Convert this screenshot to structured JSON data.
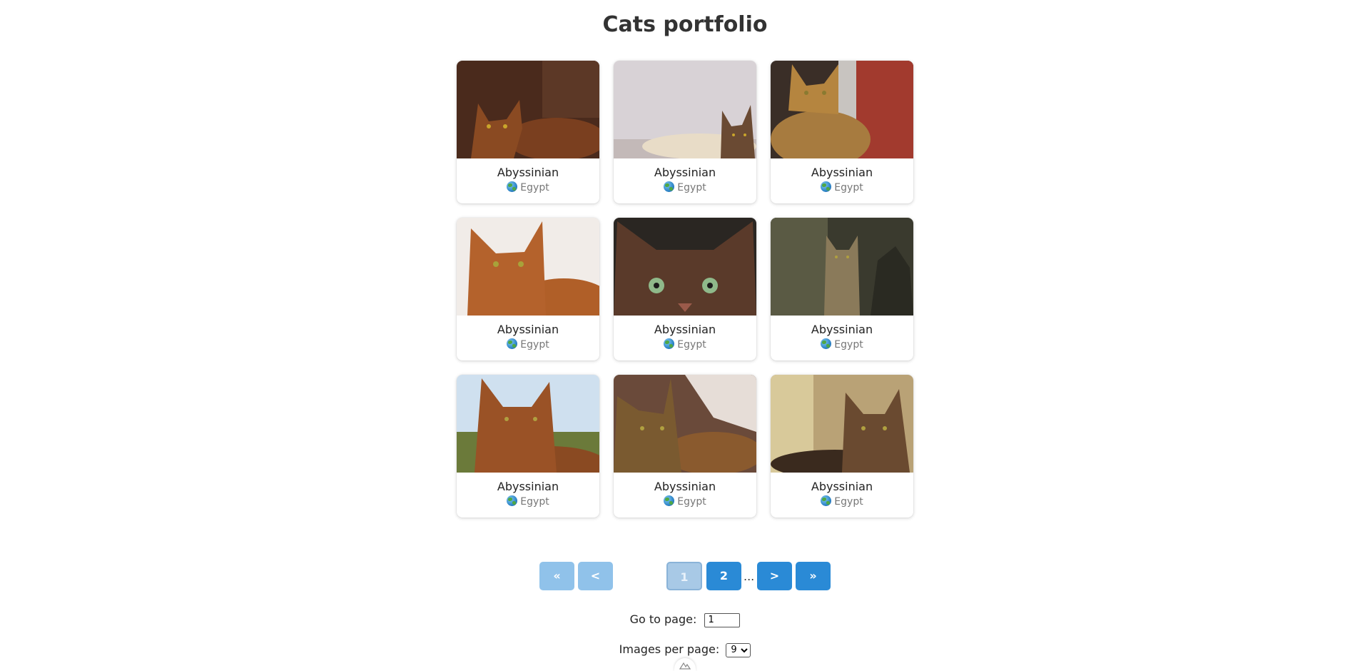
{
  "page": {
    "title": "Cats portfolio"
  },
  "cards": [
    {
      "name": "Abyssinian",
      "origin": "Egypt",
      "photo_icon": "cat-photo-icon"
    },
    {
      "name": "Abyssinian",
      "origin": "Egypt",
      "photo_icon": "cat-photo-icon"
    },
    {
      "name": "Abyssinian",
      "origin": "Egypt",
      "photo_icon": "cat-photo-icon"
    },
    {
      "name": "Abyssinian",
      "origin": "Egypt",
      "photo_icon": "cat-photo-icon"
    },
    {
      "name": "Abyssinian",
      "origin": "Egypt",
      "photo_icon": "cat-photo-icon"
    },
    {
      "name": "Abyssinian",
      "origin": "Egypt",
      "photo_icon": "cat-photo-icon"
    },
    {
      "name": "Abyssinian",
      "origin": "Egypt",
      "photo_icon": "cat-photo-icon"
    },
    {
      "name": "Abyssinian",
      "origin": "Egypt",
      "photo_icon": "cat-photo-icon"
    },
    {
      "name": "Abyssinian",
      "origin": "Egypt",
      "photo_icon": "cat-photo-icon"
    }
  ],
  "pagination": {
    "first_label": "«",
    "prev_label": "<",
    "pages": [
      "1",
      "2"
    ],
    "current_page": "1",
    "ellipsis": "...",
    "next_label": ">",
    "last_label": "»"
  },
  "goto": {
    "label": "Go to page:",
    "value": "1"
  },
  "per_page": {
    "label": "Images per page:",
    "selected": "9"
  },
  "colors": {
    "button_active": "#2a8ad6",
    "button_disabled": "#90c2ea",
    "title_text": "#333333"
  }
}
